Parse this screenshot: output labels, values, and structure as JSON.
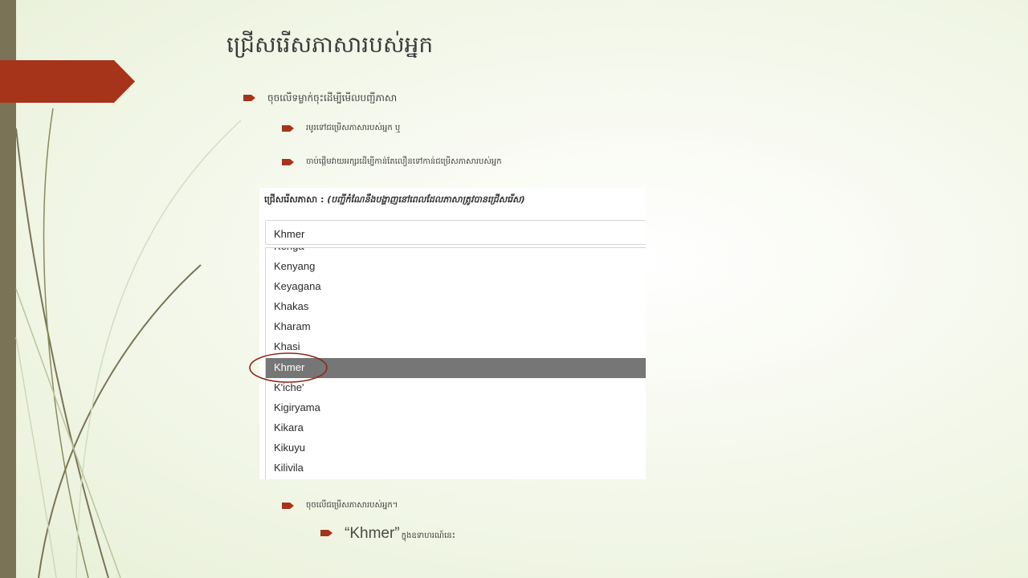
{
  "slide": {
    "title": "ជ្រើសរើសភាសារបស់អ្នក",
    "bullets": [
      "ចុចលើទម្លាក់ចុះដើម្បីមើលបញ្ជីភាសា",
      "រមូរទៅជម្រើសភាសារបស់អ្នក   ឬ",
      "ចាប់ផ្តើមវាយអក្សរដើម្បីកាន់តែលឿនទៅកាន់ជម្រើសភាសារបស់អ្នក",
      "ចុចលើជម្រើសភាសារបស់អ្នក។"
    ],
    "sub_bullet": {
      "word": "“Khmer”",
      "rest": "ក្នុងឧទាហរណ៍នេះ"
    }
  },
  "screenshot": {
    "label_main": "ជ្រើសរើសភាសា : ",
    "label_hint": "(បញ្ជីកំណែនឹងបង្ហាញនៅពេលដែលភាសាត្រូវបានជ្រើសរើស)",
    "select_value": "Khmer",
    "options": [
      "Kenga",
      "Kenyang",
      "Keyagana",
      "Khakas",
      "Kharam",
      "Khasi",
      "Khmer",
      "K'iche'",
      "Kigiryama",
      "Kikara",
      "Kikuyu",
      "Kilivila"
    ],
    "selected_option": "Khmer"
  },
  "colors": {
    "accent_red": "#A6341B",
    "left_bar": "#7A7356",
    "highlight_gray": "#767676",
    "circle": "#8B2A1A"
  },
  "icons": {
    "bullet": "arrow-bullet-icon"
  }
}
